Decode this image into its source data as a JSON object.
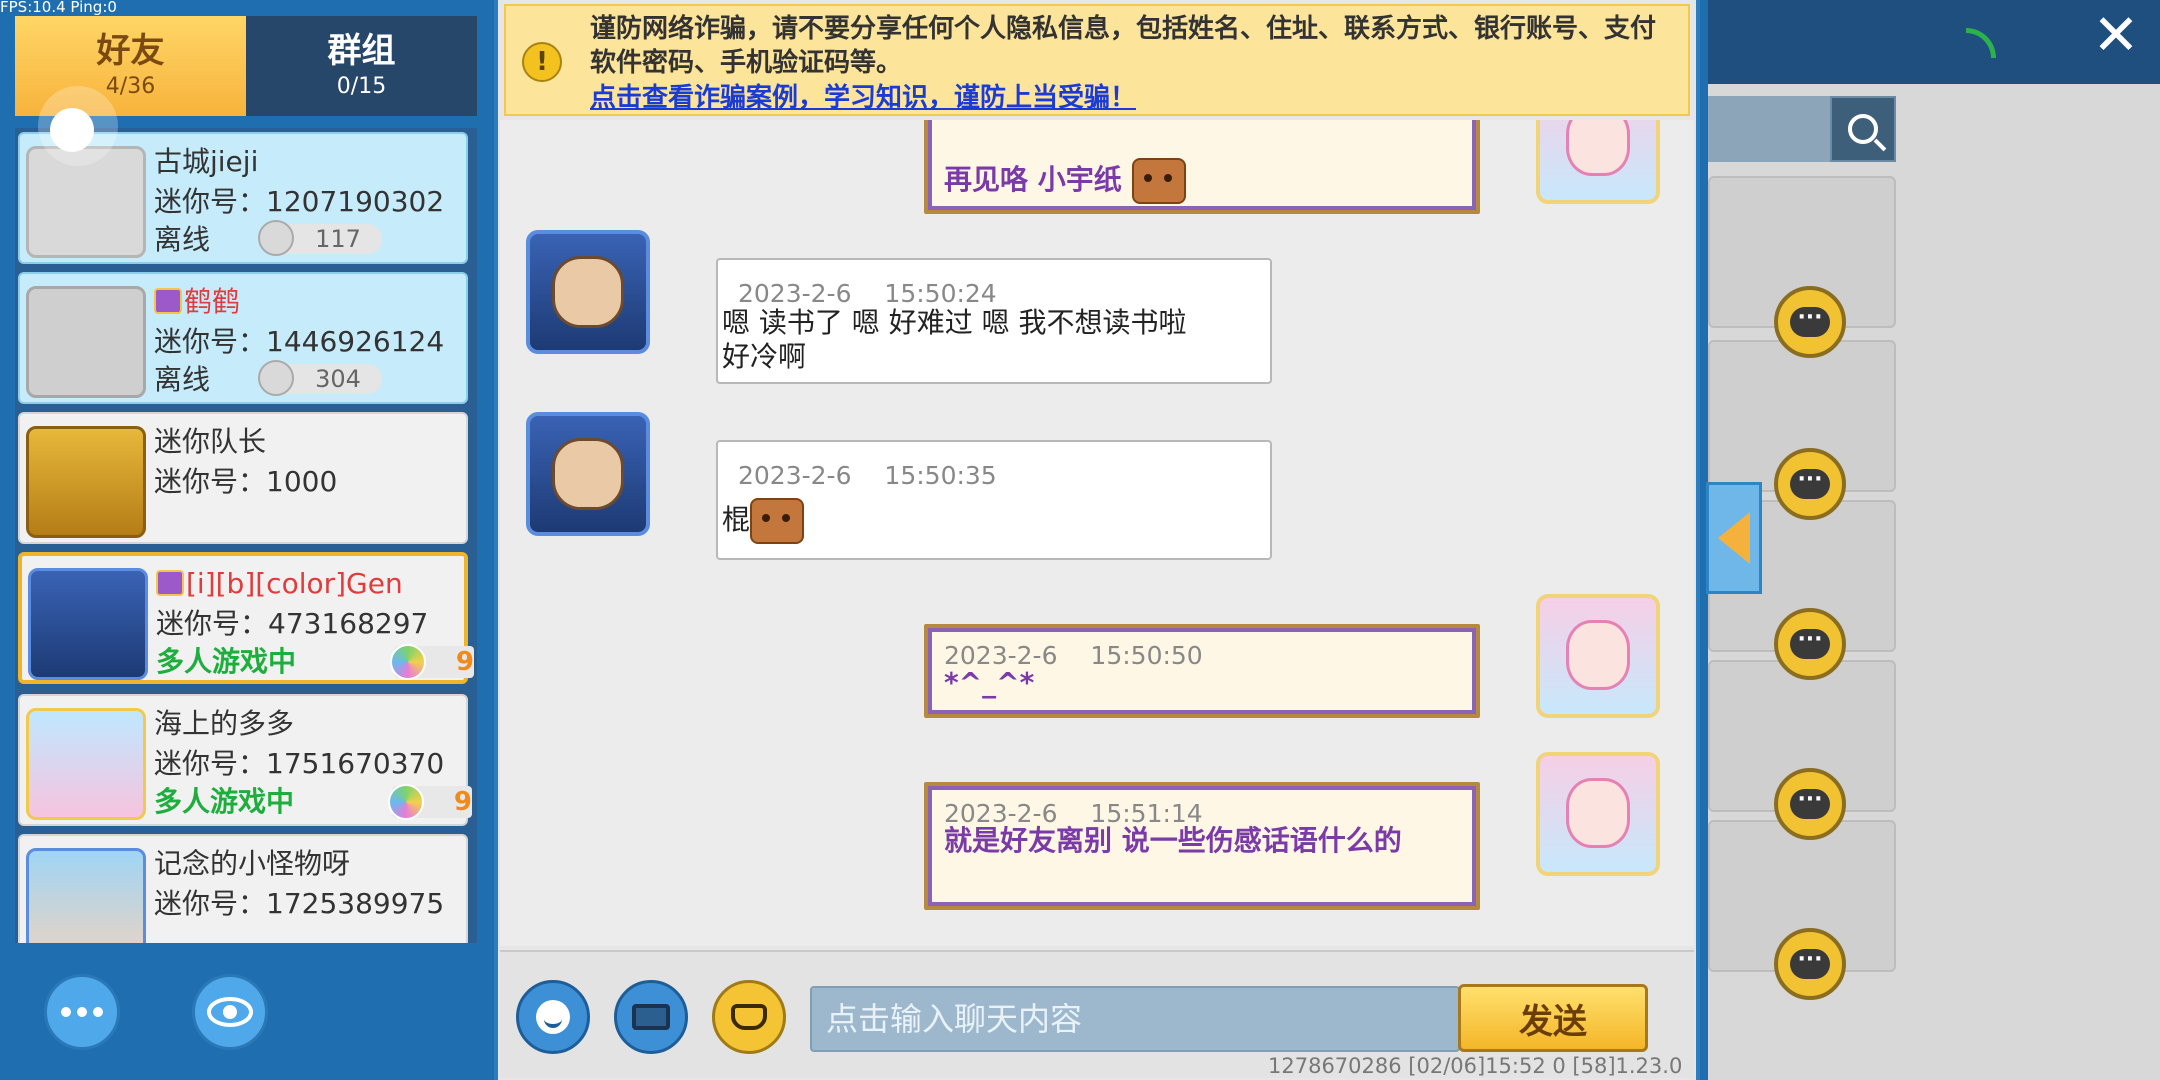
{
  "debug": {
    "fps_text": "FPS:10.4  Ping:0"
  },
  "tabs": [
    {
      "label": "好友",
      "count": "4/36"
    },
    {
      "label": "群组",
      "count": "0/15"
    }
  ],
  "friends": [
    {
      "name": "古城jieji",
      "id_label": "迷你号：1207190302",
      "status": "离线",
      "badge": "117"
    },
    {
      "name": "鹤鹤",
      "id_label": "迷你号：1446926124",
      "status": "离线",
      "badge": "304"
    },
    {
      "name": "迷你队长",
      "id_label": "迷你号：1000"
    },
    {
      "name": "[i][b][color]Gen",
      "id_label": "迷你号：473168297",
      "status": "多人游戏中",
      "room": "9"
    },
    {
      "name": "海上的多多",
      "id_label": "迷你号：1751670370",
      "status": "多人游戏中",
      "room": "9"
    },
    {
      "name": "记念的小怪物呀",
      "id_label": "迷你号：1725389975"
    }
  ],
  "warning": {
    "text": "谨防网络诈骗，请不要分享任何个人隐私信息，包括姓名、住址、联系方式、银行账号、支付软件密码、手机验证码等。",
    "link": "点击查看诈骗案例，学习知识，谨防上当受骗！"
  },
  "messages": [
    {
      "from": "self",
      "time": "",
      "text": "再见咯 小宇纸"
    },
    {
      "from": "friend",
      "time": "2023-2-6　 15:50:24",
      "text": "嗯  读书了  嗯   好难过  嗯    我不想读书啦    好冷啊"
    },
    {
      "from": "friend",
      "time": "2023-2-6　 15:50:35",
      "text": "棍"
    },
    {
      "from": "self",
      "time": "2023-2-6　 15:50:50",
      "text": "*^_^*"
    },
    {
      "from": "self",
      "time": "2023-2-6　 15:51:14",
      "text": "就是好友离别  说一些伤感话语什么的"
    }
  ],
  "input": {
    "placeholder": "点击输入聊天内容",
    "send_label": "发送"
  },
  "footer": {
    "info": "1278670286   [02/06]15:52 0   [58]1.23.0"
  },
  "icons": {
    "close": "close-icon",
    "search": "search-icon",
    "wifi": "wifi-icon",
    "more": "more-icon",
    "eye": "eye-icon",
    "emoji": "emoji-icon",
    "keyboard": "keyboard-icon",
    "gift": "gift-icon",
    "warning": "warning-icon",
    "chat": "chat-bubble-icon",
    "collapse": "collapse-arrow-icon"
  },
  "colors": {
    "accent": "#f4b628",
    "panel_blue": "#1f6fb0",
    "playing_green": "#1fae3e",
    "self_text": "#7a3aa8",
    "link_blue": "#1a3bd6"
  }
}
